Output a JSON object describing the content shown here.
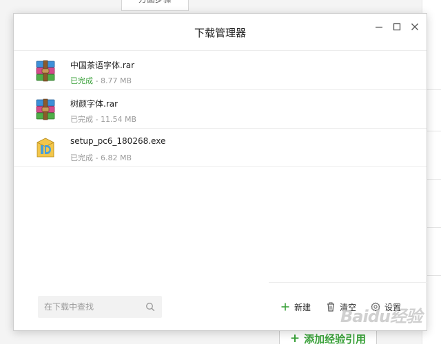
{
  "background": {
    "tab_label": "方面步骤",
    "add_button_label": "添加经验引用",
    "watermark_text": "Baidu经验",
    "colors": {
      "accent_green": "#3aa13a"
    }
  },
  "dialog": {
    "title": "下载管理器",
    "window_controls": {
      "minimize_icon": "minimize-icon",
      "maximize_icon": "maximize-icon",
      "close_icon": "close-icon"
    },
    "downloads": [
      {
        "name": "中国茶语字体.rar",
        "status": "已完成",
        "size": "8.77 MB",
        "status_color": "#3aa13a",
        "icon": "winrar-archive-icon"
      },
      {
        "name": "树颜字体.rar",
        "status": "已完成",
        "size": "11.54 MB",
        "status_color": "#999999",
        "icon": "winrar-archive-icon"
      },
      {
        "name": "setup_pc6_180268.exe",
        "status": "已完成",
        "size": "6.82 MB",
        "status_color": "#999999",
        "icon": "installer-exe-icon"
      }
    ],
    "search": {
      "placeholder": "在下载中查找",
      "value": ""
    },
    "actions": {
      "new_label": "新建",
      "clear_label": "清空",
      "settings_label": "设置"
    }
  }
}
